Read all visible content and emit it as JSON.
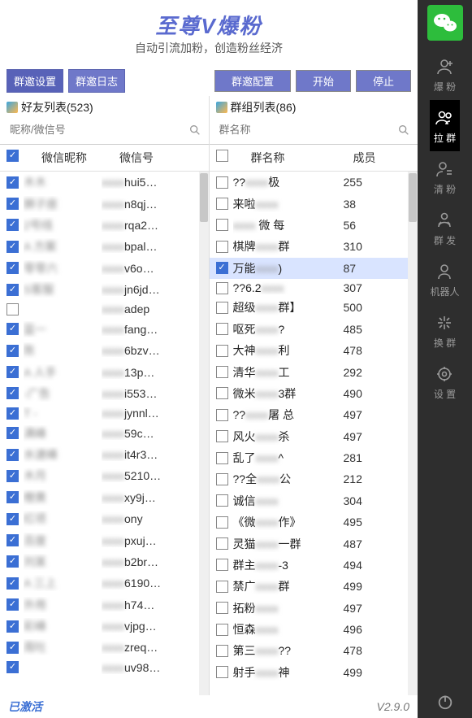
{
  "title": "至尊V爆粉",
  "subtitle": "自动引流加粉，创造粉丝经济",
  "tabs": {
    "settings": "群邀设置",
    "logs": "群邀日志"
  },
  "buttons": {
    "config": "群邀配置",
    "start": "开始",
    "stop": "停止"
  },
  "friends": {
    "header": "好友列表(523)",
    "search_placeholder": "昵称/微信号",
    "col_nick": "微信昵称",
    "col_id": "微信号"
  },
  "groups": {
    "header": "群组列表(86)",
    "search_placeholder": "群名称",
    "col_name": "群名称",
    "col_members": "成员"
  },
  "friend_rows": [
    {
      "nick": "木木",
      "id": "hui5…",
      "checked": true
    },
    {
      "nick": "狮子座",
      "id": "n8qj…",
      "checked": true
    },
    {
      "nick": "2号线",
      "id": "rqa2…",
      "checked": true
    },
    {
      "nick": "A 方案",
      "id": "bpal…",
      "checked": true
    },
    {
      "nick": "零零六",
      "id": "v6o…",
      "checked": true
    },
    {
      "nick": "S客服",
      "id": "jn6jd…",
      "checked": true
    },
    {
      "nick": "",
      "id": "adep",
      "checked": false
    },
    {
      "nick": "篮一",
      "id": "fang…",
      "checked": true
    },
    {
      "nick": "陈",
      "id": "6bzv…",
      "checked": true
    },
    {
      "nick": "A 人手",
      "id": "13p…",
      "checked": true
    },
    {
      "nick": "-广告",
      "id": "i553…",
      "checked": true
    },
    {
      "nick": "T  -",
      "id": "jynnl…",
      "checked": true
    },
    {
      "nick": "满峰",
      "id": "59c…",
      "checked": true
    },
    {
      "nick": "水速峰",
      "id": "it4r3…",
      "checked": true
    },
    {
      "nick": "木月",
      "id": "5210…",
      "checked": true
    },
    {
      "nick": "橙黄",
      "id": "xy9j…",
      "checked": true
    },
    {
      "nick": "红项",
      "id": "ony",
      "checked": true
    },
    {
      "nick": "百度",
      "id": "pxuj…",
      "checked": true
    },
    {
      "nick": "刘某",
      "id": "b2br…",
      "checked": true
    },
    {
      "nick": "A 三上",
      "id": "6190…",
      "checked": true
    },
    {
      "nick": "外用",
      "id": "h74…",
      "checked": true
    },
    {
      "nick": "彩峰",
      "id": "vjpg…",
      "checked": true
    },
    {
      "nick": "周吐",
      "id": "zreq…",
      "checked": true
    },
    {
      "nick": "",
      "id": "uv98…",
      "checked": true
    }
  ],
  "group_rows": [
    {
      "name": "?? 极",
      "cnt": 255,
      "checked": false,
      "sel": false
    },
    {
      "name": "来啦",
      "cnt": 38,
      "checked": false,
      "sel": false
    },
    {
      "name": "  微 每",
      "cnt": 56,
      "checked": false,
      "sel": false
    },
    {
      "name": "棋牌 群",
      "cnt": 310,
      "checked": false,
      "sel": false
    },
    {
      "name": "万能 )",
      "cnt": 87,
      "checked": true,
      "sel": true
    },
    {
      "name": "??6.2",
      "cnt": 307,
      "checked": false,
      "sel": false
    },
    {
      "name": "超级 群】",
      "cnt": 500,
      "checked": false,
      "sel": false
    },
    {
      "name": "呕死 ?",
      "cnt": 485,
      "checked": false,
      "sel": false
    },
    {
      "name": "大神 利",
      "cnt": 478,
      "checked": false,
      "sel": false
    },
    {
      "name": "清华 工",
      "cnt": 292,
      "checked": false,
      "sel": false
    },
    {
      "name": "微米 3群",
      "cnt": 490,
      "checked": false,
      "sel": false
    },
    {
      "name": "?? 屠 总",
      "cnt": 497,
      "checked": false,
      "sel": false
    },
    {
      "name": "风火 杀",
      "cnt": 497,
      "checked": false,
      "sel": false
    },
    {
      "name": "乱了 ^",
      "cnt": 281,
      "checked": false,
      "sel": false
    },
    {
      "name": "??全 公",
      "cnt": 212,
      "checked": false,
      "sel": false
    },
    {
      "name": "诚信",
      "cnt": 304,
      "checked": false,
      "sel": false
    },
    {
      "name": "《微 作》",
      "cnt": 495,
      "checked": false,
      "sel": false
    },
    {
      "name": "灵猫 一群",
      "cnt": 487,
      "checked": false,
      "sel": false
    },
    {
      "name": "群主 -3",
      "cnt": 494,
      "checked": false,
      "sel": false
    },
    {
      "name": "禁广 群",
      "cnt": 499,
      "checked": false,
      "sel": false
    },
    {
      "name": "拓粉",
      "cnt": 497,
      "checked": false,
      "sel": false
    },
    {
      "name": "恒森",
      "cnt": 496,
      "checked": false,
      "sel": false
    },
    {
      "name": "第三 ??",
      "cnt": 478,
      "checked": false,
      "sel": false
    },
    {
      "name": "射手 神",
      "cnt": 499,
      "checked": false,
      "sel": false
    }
  ],
  "sidebar": {
    "items": [
      {
        "key": "baofen",
        "label": "爆 粉"
      },
      {
        "key": "laqun",
        "label": "拉 群"
      },
      {
        "key": "qingfen",
        "label": "清 粉"
      },
      {
        "key": "qunfa",
        "label": "群 发"
      },
      {
        "key": "robot",
        "label": "机器人"
      },
      {
        "key": "huanqun",
        "label": "换 群"
      },
      {
        "key": "shezhi",
        "label": "设 置"
      }
    ]
  },
  "status": {
    "activated": "已激活",
    "version": "V2.9.0"
  }
}
